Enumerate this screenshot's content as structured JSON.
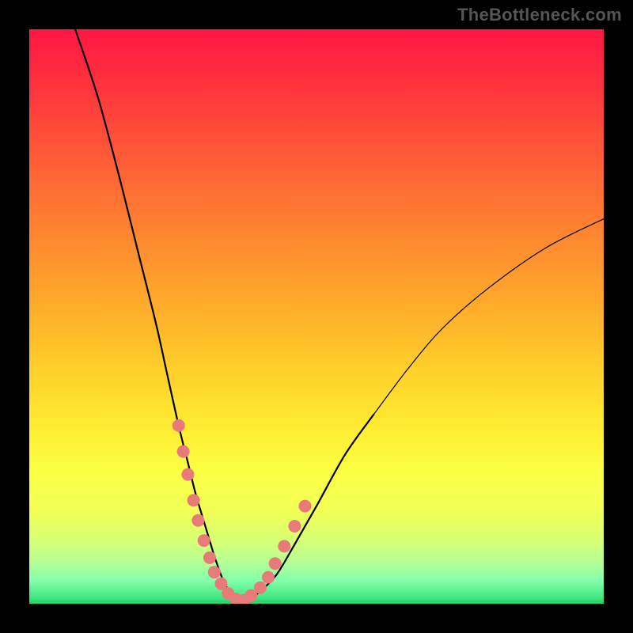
{
  "watermark": "TheBottleneck.com",
  "chart_data": {
    "type": "line",
    "title": "",
    "xlabel": "",
    "ylabel": "",
    "xlim": [
      0,
      100
    ],
    "ylim": [
      0,
      100
    ],
    "grid": false,
    "legend": false,
    "annotations": [],
    "series": [
      {
        "name": "curve",
        "x": [
          8,
          12,
          16,
          19,
          22,
          24,
          26,
          27.5,
          29,
          30.5,
          32,
          33,
          34,
          35,
          36,
          37,
          38,
          40,
          43,
          46,
          50,
          55,
          60,
          66,
          72,
          80,
          90,
          100
        ],
        "y": [
          100,
          88,
          73,
          61,
          49,
          40,
          31,
          25,
          19,
          14,
          9,
          6,
          3.5,
          2,
          1,
          0.5,
          0.7,
          2,
          5,
          10,
          17,
          26,
          33,
          41,
          48,
          55,
          62,
          67
        ]
      }
    ],
    "highlight_points": {
      "name": "beads",
      "color_hex": "#e97a7a",
      "x": [
        26.0,
        26.8,
        27.6,
        28.6,
        29.4,
        30.4,
        31.4,
        32.2,
        33.4,
        34.6,
        36.0,
        37.4,
        38.6,
        40.2,
        41.6,
        42.8,
        44.4,
        46.2,
        48.0
      ],
      "y": [
        31.0,
        26.5,
        22.5,
        18.0,
        14.5,
        11.0,
        8.0,
        5.5,
        3.5,
        1.8,
        0.8,
        0.6,
        1.4,
        2.8,
        4.6,
        7.0,
        10.0,
        13.5,
        17.0
      ]
    },
    "background_gradient": {
      "orientation": "vertical",
      "stops": [
        {
          "pos": 0.0,
          "color": "#ff1744"
        },
        {
          "pos": 0.4,
          "color": "#ff8a30"
        },
        {
          "pos": 0.7,
          "color": "#ffee33"
        },
        {
          "pos": 0.9,
          "color": "#b3ff95"
        },
        {
          "pos": 1.0,
          "color": "#1fd06a"
        }
      ]
    }
  }
}
